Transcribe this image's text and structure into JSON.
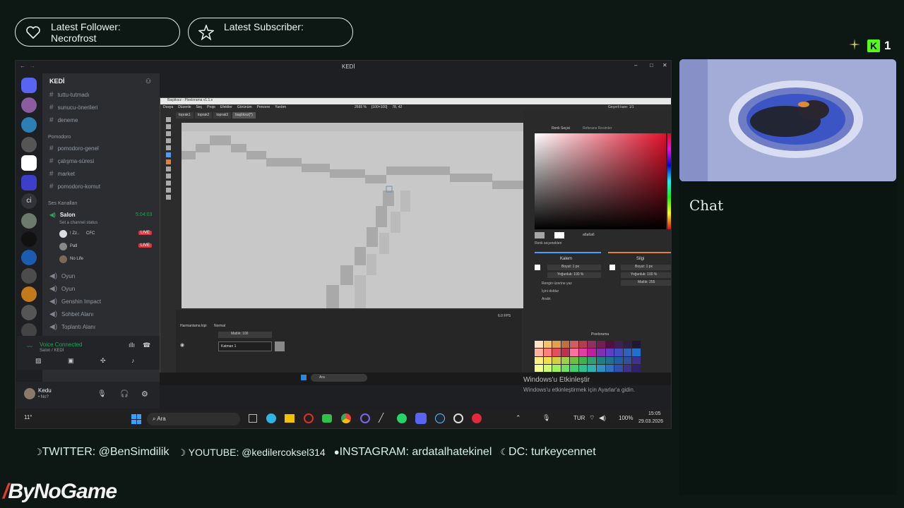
{
  "overlay": {
    "follower_label": "Latest Follower:",
    "follower_name": "Necrofrost",
    "subscriber_label": "Latest Subscriber:",
    "kick_count": "1",
    "chat_title": "Chat",
    "socials": [
      {
        "text": "TWITTER: @BenSimdilik"
      },
      {
        "text": "YOUTUBE: @kedilercoksel314"
      },
      {
        "text": "INSTAGRAM: ardatalhatekinel"
      },
      {
        "text": "DC: turkeycennet"
      }
    ],
    "brand": "ByNoGame"
  },
  "window": {
    "title": "KEDİ"
  },
  "discord": {
    "server_name": "KEDİ",
    "channels_top": [
      "tuttu-tutmadı",
      "sunucu-önerileri",
      "deneme"
    ],
    "category_pomodoro": "Pomodoro",
    "channels_pomodoro": [
      "pomodoro-genel",
      "çalışma-süresi",
      "market",
      "pomodoro-komut"
    ],
    "category_voice": "Ses Kanalları",
    "voice_active": "Salon",
    "voice_timer": "5:04:03",
    "voice_status": "Set a channel status",
    "voice_users": [
      {
        "name": "! Zz..",
        "tag": "CFC",
        "live": "LIVE"
      },
      {
        "name": "Patl",
        "live": "LIVE"
      },
      {
        "name": "No Life"
      }
    ],
    "voice_channels": [
      "Oyun",
      "Oyun",
      "Genshin Impact",
      "Sohbet Alanı",
      "Toplantı Alanı"
    ],
    "voice_connected": "Voice Connected",
    "voice_location": "Salon / KEDİ",
    "user_name": "Kedu",
    "user_status": "• No?"
  },
  "paint": {
    "title": "Başlıksız - Pixelorama v1.1.x",
    "menu": [
      "Dosya",
      "Düzenle",
      "Seç",
      "Proje",
      "Efektler",
      "Görünüm",
      "Pencere",
      "Yardım"
    ],
    "tabs": [
      "toprak1",
      "toprak2",
      "toprak3",
      "başlıksız(*)"
    ],
    "zoom": "2665 %",
    "size": "[100×100]",
    "coords": "78, 42",
    "frame_label": "Geçerli kare: 1/1",
    "color_tabs": [
      "Renk Seçici",
      "Referans Resimler"
    ],
    "hex": "a6a6a6",
    "color_options": "Renk seçenekleri",
    "tool_left": "Kalem",
    "tool_right": "Silgi",
    "brush_size_left": "Boyut: 1 px",
    "brush_size_right": "Boyut: 1 px",
    "density_left": "Yoğunluk: 100 %",
    "density_right": "Yoğunluk: 100 %",
    "opacity_right": "Matlık: 255",
    "options_left": [
      "Rengin üzerine yaz",
      "İçini doldur",
      "Aralık"
    ],
    "palette_name": "Pixelorama",
    "blend_label": "Harmanlama kipi",
    "blend_mode": "Normal",
    "opacity_label": "Matlık: 100",
    "layer_name": "Katman 1",
    "fps": "6.0 FPS",
    "activate_title": "Windows'u Etkinleştir",
    "activate_sub": "Windows'u etkinleştirmek için Ayarlar'a gidin."
  },
  "taskbar": {
    "weather": "11°",
    "search": "Ara",
    "lang": "TUR",
    "battery": "100%",
    "time": "15:05",
    "date": "29.03.2026"
  },
  "colors": {
    "accent": "#dff0ea",
    "kick": "#53fc18",
    "live": "#da373c",
    "voice_green": "#23a55a"
  }
}
